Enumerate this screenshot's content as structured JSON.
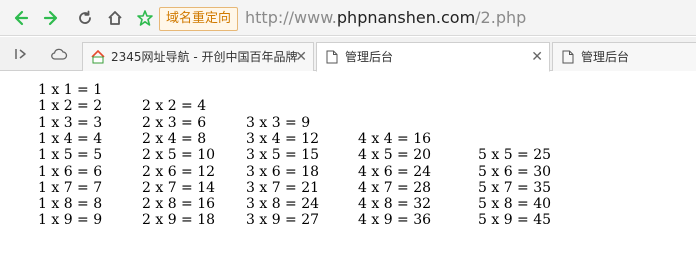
{
  "browser": {
    "redirect_badge": "域名重定向",
    "url_prefix": "http://www.",
    "url_host": "phpnanshen.com",
    "url_suffix": "/2.php"
  },
  "tabs": [
    {
      "label": "2345网址导航 - 开创中国百年品牌",
      "active": false,
      "has_close": true
    },
    {
      "label": "管理后台",
      "active": true,
      "has_close": true
    },
    {
      "label": "管理后台",
      "active": false,
      "has_close": false
    }
  ],
  "multiplication_rows": [
    [
      "1 x 1 = 1"
    ],
    [
      "1 x 2 = 2",
      "2 x 2 = 4"
    ],
    [
      "1 x 3 = 3",
      "2 x 3 = 6",
      "3 x 3 = 9"
    ],
    [
      "1 x 4 = 4",
      "2 x 4 = 8",
      "3 x 4 = 12",
      "4 x 4 = 16"
    ],
    [
      "1 x 5 = 5",
      "2 x 5 = 10",
      "3 x 5 = 15",
      "4 x 5 = 20",
      "5 x 5 = 25"
    ],
    [
      "1 x 6 = 6",
      "2 x 6 = 12",
      "3 x 6 = 18",
      "4 x 6 = 24",
      "5 x 6 = 30"
    ],
    [
      "1 x 7 = 7",
      "2 x 7 = 14",
      "3 x 7 = 21",
      "4 x 7 = 28",
      "5 x 7 = 35"
    ],
    [
      "1 x 8 = 8",
      "2 x 8 = 16",
      "3 x 8 = 24",
      "4 x 8 = 32",
      "5 x 8 = 40"
    ],
    [
      "1 x 9 = 9",
      "2 x 9 = 18",
      "3 x 9 = 27",
      "4 x 9 = 36",
      "5 x 9 = 45"
    ]
  ]
}
